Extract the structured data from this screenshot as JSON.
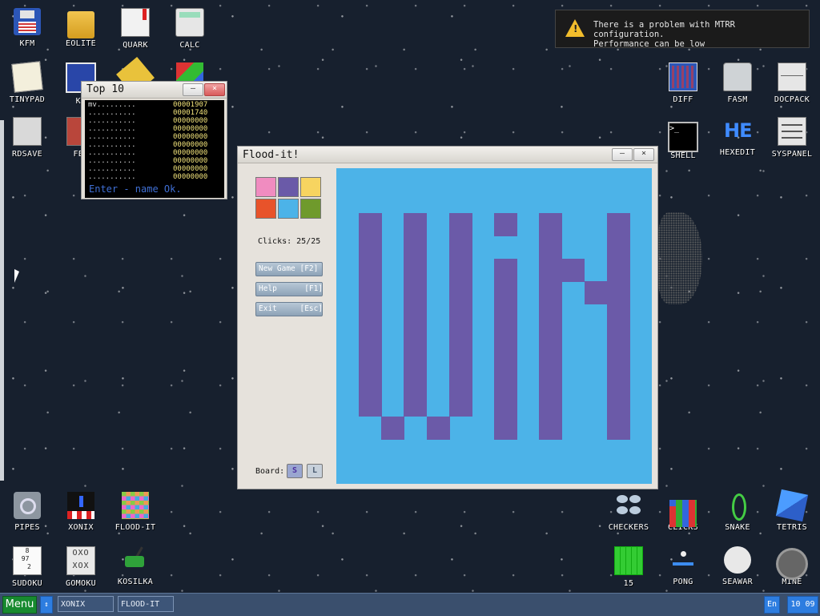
{
  "desktop": {
    "icons": [
      {
        "label": "KFM",
        "icon": "floppy-icon"
      },
      {
        "label": "EOLITE",
        "icon": "folder-icon"
      },
      {
        "label": "QUARK",
        "icon": "book-icon"
      },
      {
        "label": "CALC",
        "icon": "calculator-icon"
      },
      {
        "label": "TINYPAD",
        "icon": "notepad-icon"
      },
      {
        "label": "KF",
        "icon": "screen-icon"
      },
      {
        "label": "RDSAVE",
        "icon": "save-icon"
      },
      {
        "label": "FB2",
        "icon": "book-icon"
      },
      {
        "label": "DIFF",
        "icon": "diff-icon"
      },
      {
        "label": "FASM",
        "icon": "hdd-icon"
      },
      {
        "label": "DOCPACK",
        "icon": "cabinet-icon"
      },
      {
        "label": "SHELL",
        "icon": "terminal-icon"
      },
      {
        "label": "HEXEDIT",
        "icon": "hexedit-icon"
      },
      {
        "label": "SYSPANEL",
        "icon": "sliders-icon"
      },
      {
        "label": "PIPES",
        "icon": "pipes-icon"
      },
      {
        "label": "XONIX",
        "icon": "xonix-icon"
      },
      {
        "label": "FLOOD-IT",
        "icon": "flood-it-icon"
      },
      {
        "label": "SUDOKU",
        "icon": "sudoku-icon"
      },
      {
        "label": "GOMOKU",
        "icon": "gomoku-icon"
      },
      {
        "label": "KOSILKA",
        "icon": "lawn-mower-icon"
      },
      {
        "label": "CHECKERS",
        "icon": "checkers-icon"
      },
      {
        "label": "CLICKS",
        "icon": "clicks-icon"
      },
      {
        "label": "SNAKE",
        "icon": "snake-icon"
      },
      {
        "label": "TETRIS",
        "icon": "tetris-icon"
      },
      {
        "label": "15",
        "icon": "fifteen-icon"
      },
      {
        "label": "PONG",
        "icon": "pong-icon"
      },
      {
        "label": "SEAWAR",
        "icon": "seawar-icon"
      },
      {
        "label": "MINE",
        "icon": "mine-icon"
      }
    ],
    "sudoku_digits": "8\n97 \n 2",
    "gomoku_marks": "OXO\nXOX",
    "terminal_prompt": ">_",
    "hex_label": "HE"
  },
  "notification": {
    "icon": "warning-icon",
    "line1": "There is a problem with MTRR configuration.",
    "line2": "Performance can be low"
  },
  "top10": {
    "title": "Top 10",
    "minimize": "–",
    "close": "×",
    "rows": [
      {
        "name": "mv.........",
        "score": "00001907"
      },
      {
        "name": "...........",
        "score": "00001740"
      },
      {
        "name": "...........",
        "score": "00000000"
      },
      {
        "name": "...........",
        "score": "00000000"
      },
      {
        "name": "...........",
        "score": "00000000"
      },
      {
        "name": "...........",
        "score": "00000000"
      },
      {
        "name": "...........",
        "score": "00000000"
      },
      {
        "name": "...........",
        "score": "00000000"
      },
      {
        "name": "...........",
        "score": "00000000"
      },
      {
        "name": "...........",
        "score": "00000000"
      }
    ],
    "prompt": "Enter - name Ok."
  },
  "flood": {
    "title": "Flood-it!",
    "minimize": "–",
    "close": "×",
    "palette": [
      "#f08cc0",
      "#6a5aa8",
      "#f7d460",
      "#e8532a",
      "#4cb3e8",
      "#6f9a2c"
    ],
    "clicks_label": "Clicks: 25/25",
    "buttons": {
      "new_game": "New Game [F2]",
      "help": "Help      [F1]",
      "exit": "Exit     [Esc]"
    },
    "board_label": "Board:",
    "size_small": "S",
    "size_large": "L",
    "board_colors": {
      "background": "#4cb3e8",
      "pattern": "#6b5aa8"
    },
    "pattern_rows": [
      "..............",
      "..............",
      ".X.X.X.X.X..X.",
      ".X.X.X...X..X.",
      ".X.X.X.X.XX.X.",
      ".X.X.X.X.X.XX.",
      ".X.X.X.X.X..X.",
      ".X.X.X.X.X..X.",
      ".X.X.X.X.X..X.",
      ".X.X.X.X.X..X.",
      ".X.X.X.X.X..X.",
      "..X.X..X.X..X.",
      "..............",
      ".............."
    ]
  },
  "taskbar": {
    "menu_label": "Menu",
    "switch_glyph": "↕",
    "tasks": [
      "XONIX",
      "FLOOD-IT"
    ],
    "language": "En",
    "clock": "10 09"
  }
}
